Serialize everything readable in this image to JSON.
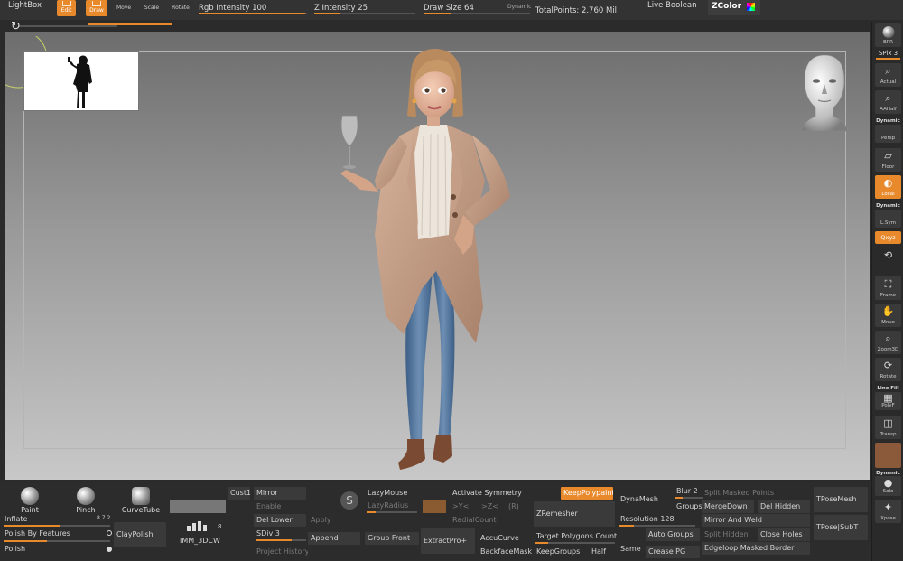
{
  "topbar": {
    "lightbox": "LightBox",
    "edit": "Edit",
    "draw": "Draw",
    "move": "Move",
    "scale": "Scale",
    "rotate": "Rotate",
    "rgb_intensity": "Rgb Intensity 100",
    "z_intensity": "Z Intensity 25",
    "draw_size": "Draw Size 64",
    "dynamic": "Dynamic",
    "total_points": "TotalPoints: 2.760 Mil",
    "live_boolean": "Live Boolean",
    "zcolor": "ZColor"
  },
  "right_shelf": {
    "bpr": "BPR",
    "spix": "SPix 3",
    "actual": "Actual",
    "aahalf": "AAHalf",
    "dynamic": "Dynamic",
    "persp": "Persp",
    "floor": "Floor",
    "local": "Local",
    "dynamic2": "Dynamic",
    "lsym": "L.Sym",
    "xyz": "Qxyz",
    "frame": "Frame",
    "move": "Move",
    "zoom3d": "Zoom3D",
    "rotate": "Rotate",
    "linefill": "Line Fill",
    "polyf": "PolyF",
    "transp": "Transp",
    "dynamic3": "Dynamic",
    "solo": "Solo",
    "xpose": "Xpose"
  },
  "bottom": {
    "paint": "Paint",
    "pinch": "Pinch",
    "curvetube": "CurveTube",
    "inflate": "Inflate",
    "inflate_val": "8 7 2",
    "polish_features": "Polish By Features",
    "polish": "Polish",
    "claypolish": "ClayPolish",
    "imm": "IMM_3DCW",
    "imm_count": "8",
    "cust1": "Cust1",
    "mirror": "Mirror",
    "enable": "Enable",
    "del_lower": "Del Lower",
    "apply": "Apply",
    "sdiv": "SDiv 3",
    "append": "Append",
    "project_history": "Project History",
    "lazymouse": "LazyMouse",
    "lazyradius": "LazyRadius",
    "group_front": "Group Front",
    "activate_symmetry": "Activate Symmetry",
    "sym_x": ">X<",
    "sym_y": ">Y<",
    "sym_z": ">Z<",
    "sym_r": "(R)",
    "radialcount": "RadialCount",
    "extractpro": "ExtractPro+",
    "accucurve": "AccuCurve",
    "backfacemask": "BackfaceMask",
    "keeppolypaint": "KeepPolypaint",
    "zremesher": "ZRemesher",
    "target_polygons": "Target Polygons Count 1",
    "keepgroups": "KeepGroups",
    "half": "Half",
    "same": "Same",
    "dynamesh": "DynaMesh",
    "blur": "Blur 2",
    "groups": "Groups",
    "resolution": "Resolution 128",
    "auto_groups": "Auto Groups",
    "crease_pg": "Crease PG",
    "split_masked": "Split Masked Points",
    "mergedown": "MergeDown",
    "del_hidden": "Del Hidden",
    "mirror_weld": "Mirror And Weld",
    "split_hidden": "Split Hidden",
    "close_holes": "Close Holes",
    "edgeloop_masked": "Edgeloop Masked Border",
    "tposemesh": "TPoseMesh",
    "tpose_subt": "TPose|SubT"
  }
}
